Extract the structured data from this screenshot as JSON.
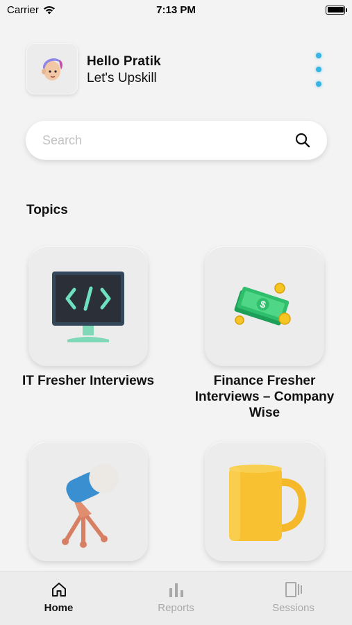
{
  "status_bar": {
    "carrier": "Carrier",
    "time": "7:13 PM"
  },
  "header": {
    "greeting": "Hello Pratik",
    "subtitle": "Let's Upskill"
  },
  "search": {
    "placeholder": "Search"
  },
  "topics": {
    "title": "Topics",
    "items": [
      {
        "label": "IT Fresher Interviews",
        "icon": "monitor-code-icon"
      },
      {
        "label": "Finance Fresher Interviews – Company Wise",
        "icon": "money-stack-icon"
      },
      {
        "label": "",
        "icon": "microphone-icon"
      },
      {
        "label": "",
        "icon": "mug-icon"
      }
    ]
  },
  "tabbar": {
    "items": [
      {
        "label": "Home",
        "icon": "home-icon",
        "active": true
      },
      {
        "label": "Reports",
        "icon": "bar-chart-icon",
        "active": false
      },
      {
        "label": "Sessions",
        "icon": "sessions-icon",
        "active": false
      }
    ]
  },
  "colors": {
    "accent_dot": "#35b6e6",
    "background": "#f3f3f3"
  }
}
